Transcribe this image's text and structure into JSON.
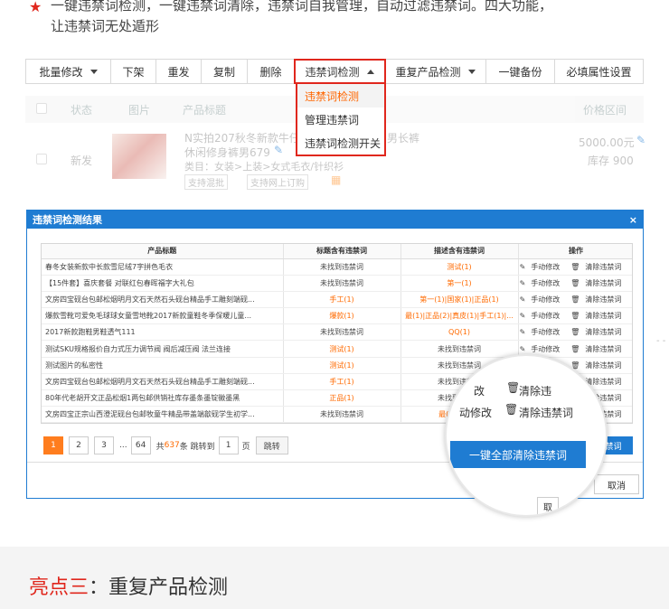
{
  "intro": {
    "line1": "一键违禁词检测，一键违禁词清除，违禁词自我管理，自动过滤违禁词。四大功能，",
    "line2": "让违禁词无处遁形",
    "star_color": "#e0271d"
  },
  "toolbar": {
    "batch_edit": "批量修改",
    "delist": "下架",
    "relist": "重发",
    "copy": "复制",
    "delete": "删除",
    "forbidden_check": "违禁词检测",
    "dup_check": "重复产品检测",
    "backup": "一键备份",
    "required_attrs": "必填属性设置"
  },
  "dropdown": {
    "items": [
      "违禁词检测",
      "管理违禁词",
      "违禁词检测开关"
    ]
  },
  "list": {
    "headers": {
      "status": "状态",
      "image": "图片",
      "title": "产品标题",
      "price_range": "价格区间"
    },
    "row": {
      "status": "新发",
      "title_line1": "N实拍207秋冬新款牛仔",
      "title_line1_tail": "男长裤",
      "title_line2": "休闲修身裤男679",
      "category": "类目：女装>上装>女式毛衣/针织衫",
      "tag1": "支持混批",
      "tag2": "支持网上订购",
      "price": "5000.00元",
      "stock": "库存 900"
    }
  },
  "modal": {
    "title": "违禁词检测结果",
    "close": "×",
    "columns": [
      "产品标题",
      "标题含有违禁词",
      "描述含有违禁词",
      "操作"
    ],
    "rows": [
      {
        "title": "春冬女装新款中长款雪尼绒7字拼色毛衣",
        "t": "未找到违禁词",
        "t_hit": false,
        "d": "测试(1)",
        "d_hit": true
      },
      {
        "title": "【15件套】喜庆套餐 对联红包春晖福字大礼包",
        "t": "未找到违禁词",
        "t_hit": false,
        "d": "第一(1)",
        "d_hit": true
      },
      {
        "title": "文房四宝砚台包邮松烟明月文石天然石头砚台精品手工雕刻端砚...",
        "t": "手工(1)",
        "t_hit": true,
        "d": "第一(1)|国家(1)|正品(1)",
        "d_hit": true
      },
      {
        "title": "爆款雪靴可爱免毛球球女童雪地靴2017新款童鞋冬季保暖儿童...",
        "t": "爆款(1)",
        "t_hit": true,
        "d": "最(1)|正品(2)|真皮(1)|手工(1)|...",
        "d_hit": true
      },
      {
        "title": "2017新款跑鞋男鞋透气111",
        "t": "未找到违禁词",
        "t_hit": false,
        "d": "QQ(1)",
        "d_hit": true
      },
      {
        "title": "测试SKU规格报价自力式压力调节阀 阀后减压阀 法兰连接",
        "t": "测试(1)",
        "t_hit": true,
        "d": "未找到违禁词",
        "d_hit": false
      },
      {
        "title": "测试图片的私密性",
        "t": "测试(1)",
        "t_hit": true,
        "d": "未找到违禁词",
        "d_hit": false
      },
      {
        "title": "文房四宝砚台包邮松烟明月文石天然石头砚台精品手工雕刻端砚...",
        "t": "手工(1)",
        "t_hit": true,
        "d": "未找到违禁词",
        "d_hit": false
      },
      {
        "title": "80年代老胡开文正品松烟1两包邮供销社库存墨条墨锭徽墨黑",
        "t": "正品(1)",
        "t_hit": true,
        "d": "未找到违禁词",
        "d_hit": false
      },
      {
        "title": "文房四宝正宗山西澄泥砚台包邮牧童牛精品带盖端歙砚学生初学...",
        "t": "未找到违禁词",
        "t_hit": false,
        "d": "最(1)|国家...",
        "d_hit": true
      }
    ],
    "op_edit": "手动修改",
    "op_clear": "清除违禁词",
    "pager": {
      "pages": [
        "1",
        "2",
        "3"
      ],
      "ellipsis": "...",
      "last": "64",
      "total_prefix": "共",
      "total": "637",
      "total_suffix": "条 跳转到",
      "current": "1",
      "page_unit": "页",
      "jump": "跳转"
    },
    "clear_all": "一键全部清除违禁词",
    "clear_all_short": "清除违禁词",
    "cancel": "取消"
  },
  "magnifier": {
    "line1_left": "改",
    "line1_right": "清除违",
    "line2_left": "动修改",
    "line2_right": "清除违禁词",
    "button": "一键全部清除违禁词",
    "peek": "取"
  },
  "section": {
    "highlight": "亮点三",
    "rest": "：重复产品检测"
  },
  "colors": {
    "accent_red": "#e0271d",
    "orange": "#ff6a00",
    "modal_blue": "#1f7cd2"
  }
}
